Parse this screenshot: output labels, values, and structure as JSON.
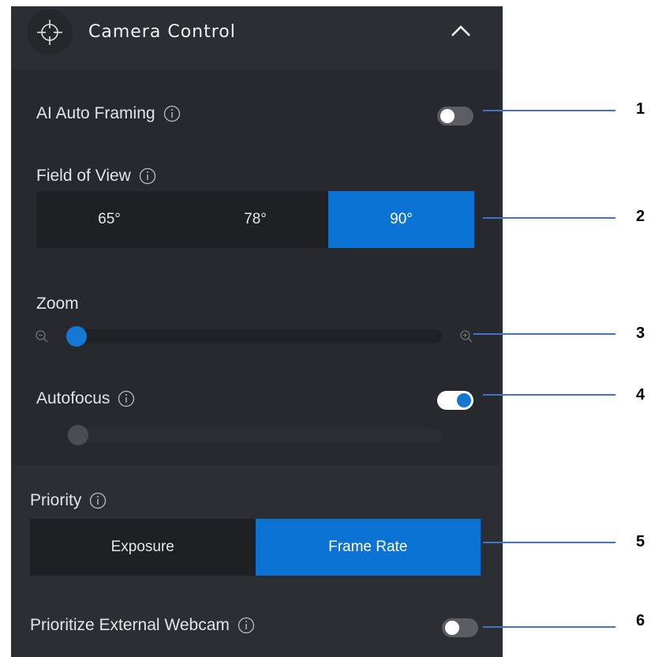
{
  "header": {
    "title": "Camera Control",
    "icon": "crosshair-icon",
    "collapse_icon": "chevron-up-icon"
  },
  "ai_auto_framing": {
    "label": "AI Auto Framing",
    "enabled": false
  },
  "field_of_view": {
    "label": "Field of View",
    "options": [
      {
        "label": "65°",
        "selected": false
      },
      {
        "label": "78°",
        "selected": false
      },
      {
        "label": "90°",
        "selected": true
      }
    ]
  },
  "zoom": {
    "label": "Zoom",
    "level": 0,
    "zoom_out_icon": "zoom-out-icon",
    "zoom_in_icon": "zoom-in-icon"
  },
  "autofocus": {
    "label": "Autofocus",
    "enabled": true,
    "focus_level": 0
  },
  "priority": {
    "label": "Priority",
    "options": [
      {
        "label": "Exposure",
        "selected": false
      },
      {
        "label": "Frame Rate",
        "selected": true
      }
    ]
  },
  "prioritize_external_webcam": {
    "label": "Prioritize External Webcam",
    "enabled": false
  },
  "callouts": [
    "1",
    "2",
    "3",
    "4",
    "5",
    "6"
  ],
  "colors": {
    "accent": "#0b73d4",
    "panel": "#2b2e33",
    "callout_line": "#4472c4"
  }
}
